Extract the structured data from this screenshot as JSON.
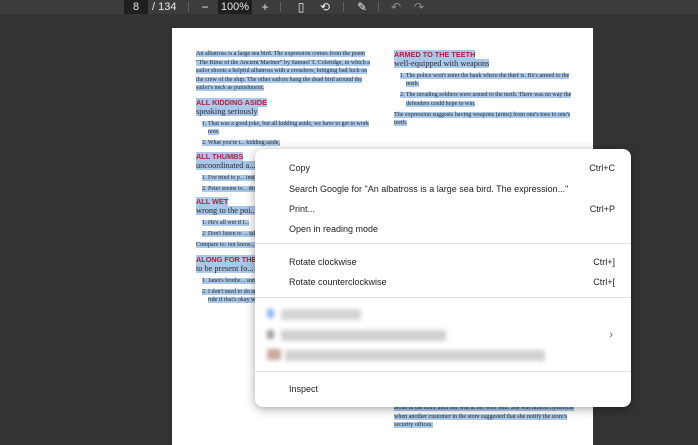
{
  "toolbar": {
    "page_current": "8",
    "page_total": "/ 134",
    "zoom_out": "−",
    "zoom_level": "100%",
    "zoom_in": "+",
    "fit_icon": "▯",
    "rotate_icon": "⟲",
    "annotate_icon": "✎",
    "undo_icon": "↶",
    "redo_icon": "↷"
  },
  "doc": {
    "col1": {
      "intro": "An albatross is a large sea bird. The expression comes from the poem \"The Rime of the Ancient Mariner\" by Samuel T. Coleridge, in which a sailor shoots a helpful albatross with a crossbow, bringing bad luck on the crew of the ship. The other sailors hang the dead bird around the sailor's neck as punishment.",
      "h1": "ALL KIDDING ASIDE",
      "s1": "speaking seriously",
      "l1a": "1. That was a good joke, but all kidding aside, we have to get to work now.",
      "l1b": "2. What you're t... kidding aside,",
      "h2": "ALL THUMBS",
      "s2": "uncoordinated a... one's hands",
      "l2a": "1. I've tried to p... instructions, I... the parts to fit",
      "l2b": "2. Peter seems to... dropping his t...",
      "h3": "ALL WET",
      "s3": "wrong to the poi...",
      "l3a": "1. He's all wet if I...",
      "l3b": "2. Don't listen to ... talking about.",
      "l3c": "Compare to: not know... for the birds; talk thr...",
      "h4": "ALONG FOR THE ...",
      "s4": "to be present fo... in it",
      "l4a": "1. Janet's brothe... some fishing, ... for the ride.",
      "l4b": "2. I don't need to do any shopping, but perhaps I'll come along for the ride if that's okay with you."
    },
    "col2": {
      "h1": "ARMED TO THE TEETH",
      "s1": "well-equipped with weapons",
      "l1a": "1. The police won't enter the bank where the thief is. He's armed to the teeth.",
      "l1b": "2. The invading soldiers were armed to the teeth. There was no way the defenders could hope to win.",
      "p1": "The expression suggests having weapons (arms) from one's toes to one's teeth.",
      "bottom": "alone in the store until she was at her wits' end. She was almost hysterical when another customer in the store suggested that she notify the store's security offices."
    }
  },
  "context_menu": {
    "copy": "Copy",
    "copy_shortcut": "Ctrl+C",
    "search": "Search Google for \"An albatross is a large sea bird. The expression...\"",
    "print": "Print...",
    "print_shortcut": "Ctrl+P",
    "reading_mode": "Open in reading mode",
    "rotate_cw": "Rotate clockwise",
    "rotate_cw_shortcut": "Ctrl+]",
    "rotate_ccw": "Rotate counterclockwise",
    "rotate_ccw_shortcut": "Ctrl+[",
    "submenu_chevron": "›",
    "inspect": "Inspect"
  },
  "colors": {
    "selection": "#a9c8ea",
    "heading_red": "#b3203a",
    "toolbar": "#3c3c3c"
  }
}
